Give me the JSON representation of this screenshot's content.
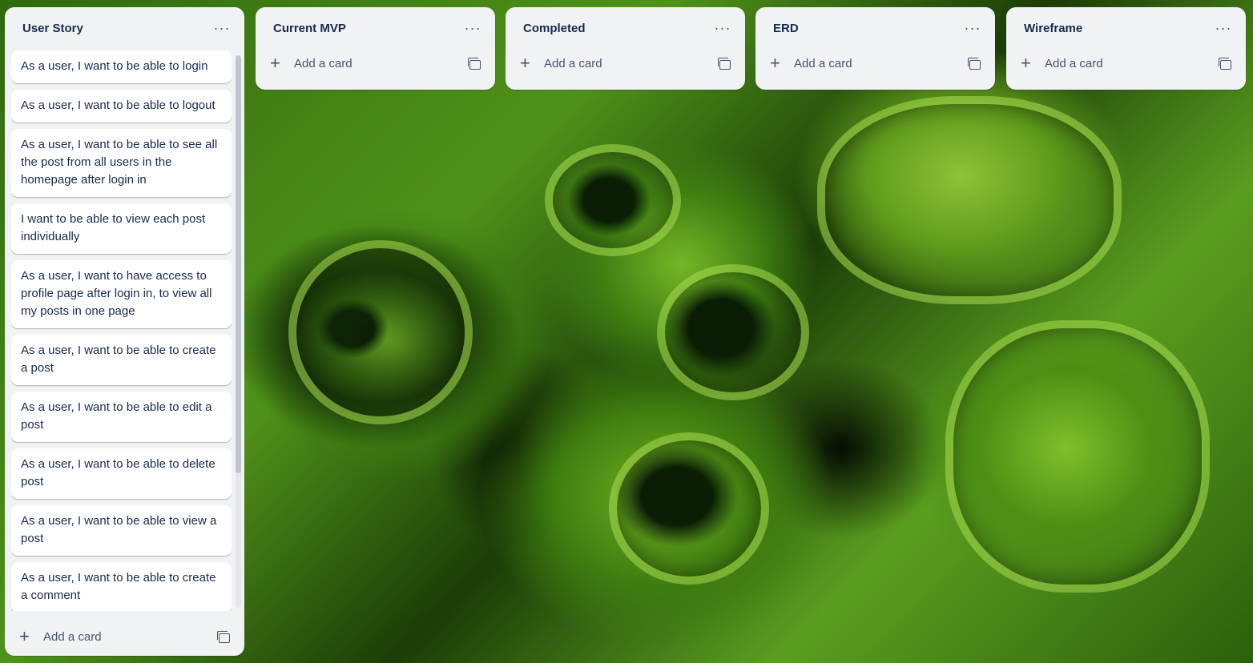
{
  "lists": [
    {
      "title": "User Story",
      "menu_icon": "ellipsis-icon",
      "cards": [
        "As a user, I want to be able to login",
        "As a user, I want to be able to logout",
        "As a user, I want to be able to see all the post from all users in the homepage after login in",
        "I want to be able to view each post individually",
        "As a user, I want to have access to profile page after login in, to view all my posts in one page",
        "As a user, I want to be able to create a post",
        "As a user, I want to be able to edit a post",
        "As a user, I want to be able to delete post",
        "As a user, I want to be able to view a post",
        "As a user, I want to be able to create a comment"
      ],
      "add_card_label": "Add a card"
    },
    {
      "title": "Current MVP",
      "cards": [],
      "add_card_label": "Add a card"
    },
    {
      "title": "Completed",
      "cards": [],
      "add_card_label": "Add a card"
    },
    {
      "title": "ERD",
      "cards": [],
      "add_card_label": "Add a card"
    },
    {
      "title": "Wireframe",
      "cards": [],
      "add_card_label": "Add a card"
    }
  ],
  "icons": {
    "menu": "ellipsis-icon",
    "add": "plus-icon",
    "template": "card-template-icon"
  },
  "colors": {
    "list_bg": "#f1f2f4",
    "card_bg": "#ffffff",
    "text": "#172b4d",
    "subtle_text": "#44546f",
    "board_background": "#3f7d10"
  }
}
